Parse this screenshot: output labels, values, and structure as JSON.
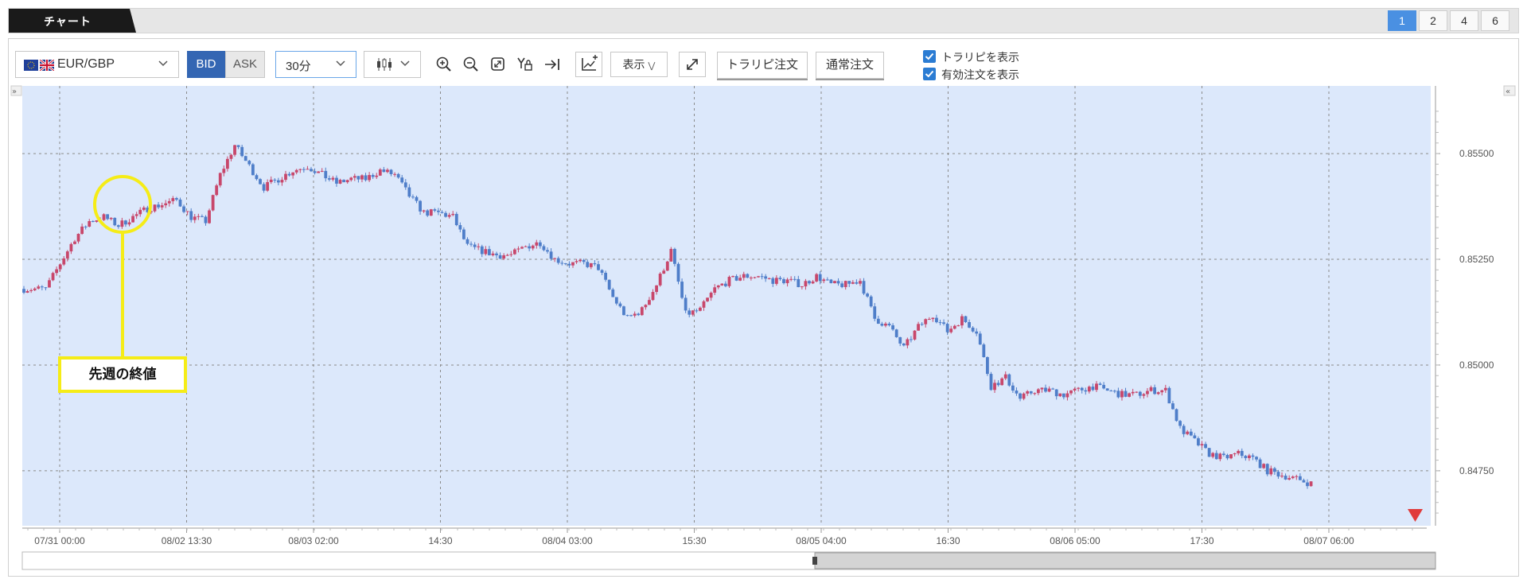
{
  "window": {
    "title": "チャート",
    "layout_buttons": [
      "1",
      "2",
      "4",
      "6"
    ],
    "active_layout": "1"
  },
  "toolbar": {
    "pair": "EUR/GBP",
    "bid_label": "BID",
    "ask_label": "ASK",
    "interval": "30分",
    "display_label": "表示",
    "tralipi_order_label": "トラリピ注文",
    "normal_order_label": "通常注文",
    "show_tralipi_label": "トラリピを表示",
    "show_active_orders_label": "有効注文を表示",
    "show_tralipi_checked": true,
    "show_active_orders_checked": true
  },
  "annotation": {
    "label": "先週の終値"
  },
  "colors": {
    "up": "#c8476b",
    "down": "#4f7ec9",
    "plot_bg": "#dce8fb",
    "annotation": "#f5ec17",
    "accent": "#4a90e2"
  },
  "chart_data": {
    "type": "candlestick",
    "symbol": "EUR/GBP",
    "timeframe": "30分",
    "y_ticks": [
      0.8475,
      0.85,
      0.8525,
      0.855
    ],
    "y_tick_labels": [
      "0.84750",
      "0.85000",
      "0.85250",
      "0.85500"
    ],
    "ylim": [
      0.8462,
      0.8566
    ],
    "x_tick_labels": [
      "07/31 00:00",
      "08/02 13:30",
      "08/03 02:00",
      "14:30",
      "08/04 03:00",
      "15:30",
      "08/05 04:00",
      "16:30",
      "08/06 05:00",
      "17:30",
      "08/07 06:00"
    ],
    "close_series": [
      [
        0,
        0.8518
      ],
      [
        6,
        0.8518
      ],
      [
        10,
        0.8524
      ],
      [
        14,
        0.853
      ],
      [
        18,
        0.8534
      ],
      [
        22,
        0.8535
      ],
      [
        26,
        0.8533
      ],
      [
        30,
        0.8535
      ],
      [
        34,
        0.8537
      ],
      [
        38,
        0.8538
      ],
      [
        42,
        0.8539
      ],
      [
        46,
        0.8535
      ],
      [
        50,
        0.8534
      ],
      [
        54,
        0.8545
      ],
      [
        58,
        0.8552
      ],
      [
        62,
        0.8547
      ],
      [
        66,
        0.8542
      ],
      [
        70,
        0.8544
      ],
      [
        74,
        0.8546
      ],
      [
        78,
        0.8547
      ],
      [
        82,
        0.8545
      ],
      [
        86,
        0.8543
      ],
      [
        90,
        0.8544
      ],
      [
        94,
        0.8544
      ],
      [
        98,
        0.8546
      ],
      [
        102,
        0.8545
      ],
      [
        106,
        0.854
      ],
      [
        110,
        0.8536
      ],
      [
        114,
        0.8536
      ],
      [
        118,
        0.8535
      ],
      [
        122,
        0.8528
      ],
      [
        126,
        0.8527
      ],
      [
        130,
        0.8526
      ],
      [
        134,
        0.8526
      ],
      [
        138,
        0.8528
      ],
      [
        142,
        0.8529
      ],
      [
        146,
        0.8525
      ],
      [
        150,
        0.8524
      ],
      [
        154,
        0.8524
      ],
      [
        158,
        0.8523
      ],
      [
        162,
        0.8516
      ],
      [
        166,
        0.8511
      ],
      [
        170,
        0.8513
      ],
      [
        174,
        0.8519
      ],
      [
        178,
        0.8527
      ],
      [
        182,
        0.8512
      ],
      [
        186,
        0.8513
      ],
      [
        190,
        0.8518
      ],
      [
        194,
        0.852
      ],
      [
        198,
        0.8521
      ],
      [
        202,
        0.8521
      ],
      [
        206,
        0.852
      ],
      [
        210,
        0.852
      ],
      [
        214,
        0.8519
      ],
      [
        218,
        0.8521
      ],
      [
        222,
        0.8519
      ],
      [
        226,
        0.8519
      ],
      [
        230,
        0.852
      ],
      [
        234,
        0.8511
      ],
      [
        238,
        0.8509
      ],
      [
        242,
        0.8504
      ],
      [
        246,
        0.8509
      ],
      [
        250,
        0.8512
      ],
      [
        254,
        0.8508
      ],
      [
        258,
        0.8511
      ],
      [
        262,
        0.8508
      ],
      [
        266,
        0.8495
      ],
      [
        270,
        0.8497
      ],
      [
        274,
        0.8492
      ],
      [
        278,
        0.8494
      ],
      [
        282,
        0.8494
      ],
      [
        286,
        0.8493
      ],
      [
        290,
        0.8494
      ],
      [
        294,
        0.8495
      ],
      [
        298,
        0.8494
      ],
      [
        302,
        0.8493
      ],
      [
        306,
        0.8493
      ],
      [
        310,
        0.8494
      ],
      [
        314,
        0.8494
      ],
      [
        318,
        0.8485
      ],
      [
        322,
        0.8482
      ],
      [
        326,
        0.8479
      ],
      [
        330,
        0.8478
      ],
      [
        334,
        0.8479
      ],
      [
        338,
        0.8478
      ],
      [
        342,
        0.8475
      ],
      [
        346,
        0.8474
      ],
      [
        350,
        0.8473
      ],
      [
        354,
        0.8472
      ]
    ]
  }
}
